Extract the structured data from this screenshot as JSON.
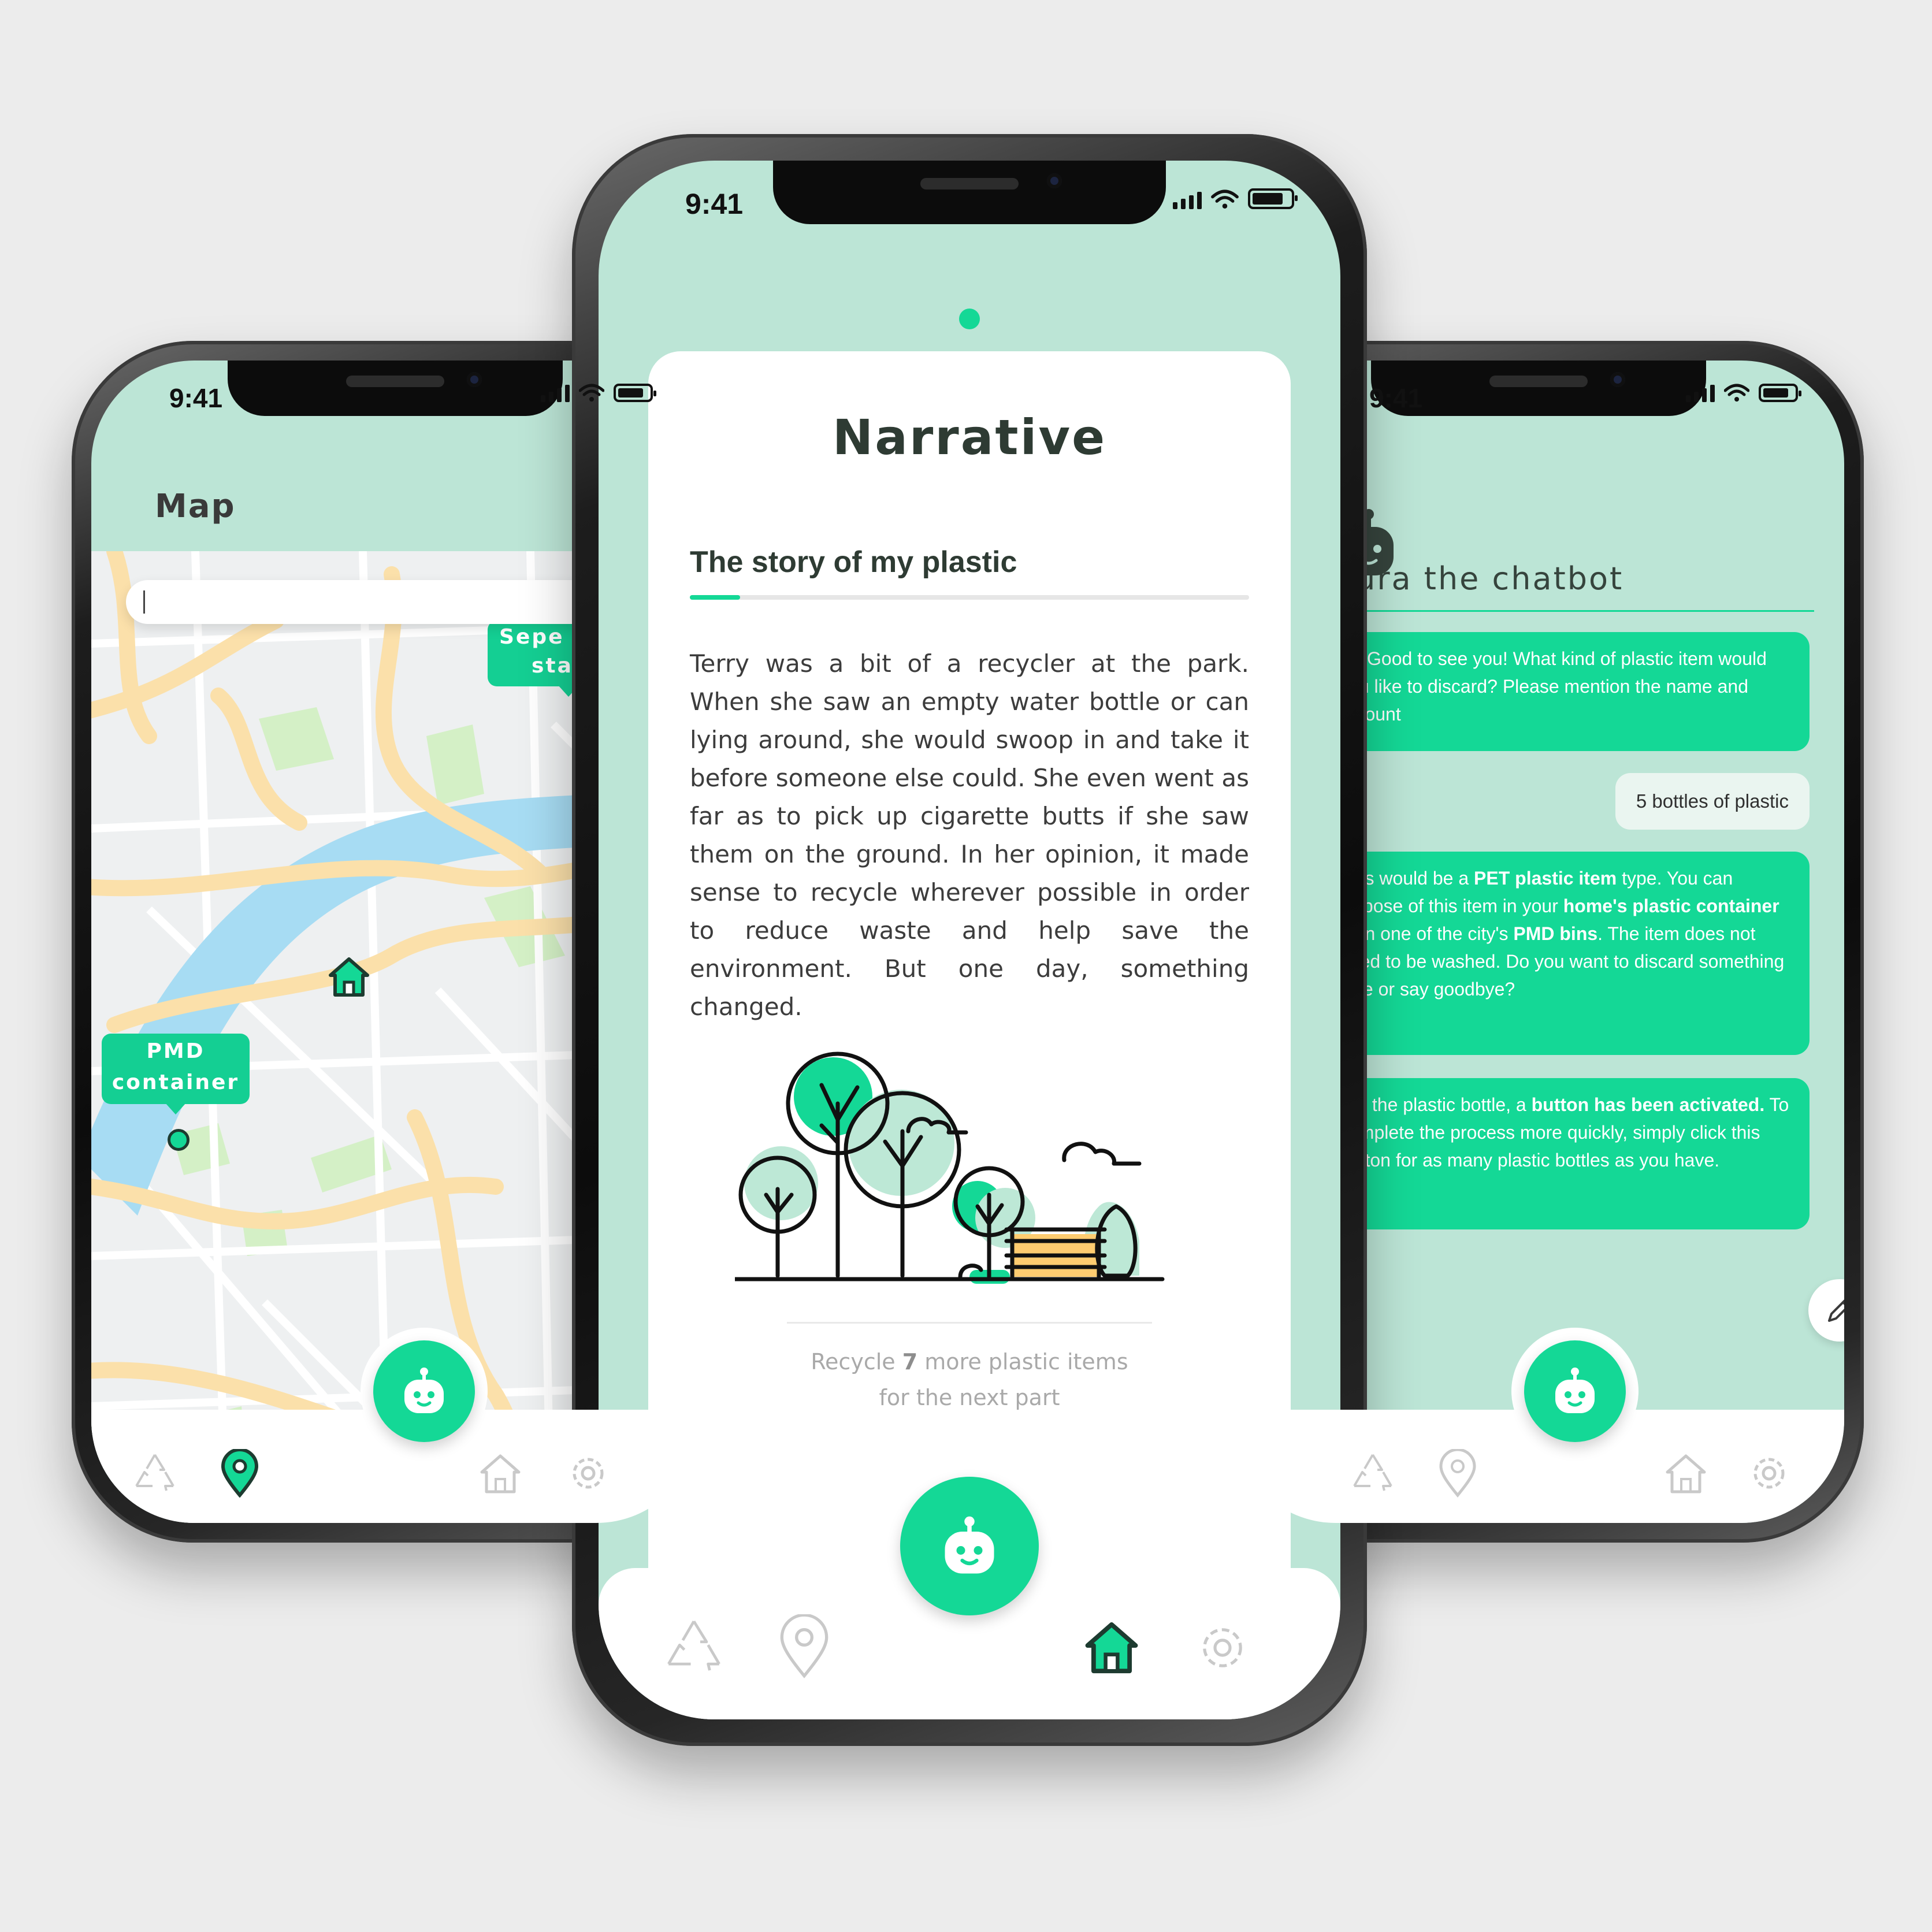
{
  "colors": {
    "accent": "#14d896",
    "screen_background": "#bce5d6",
    "page_background": "#ececec",
    "map_water": "#a7dcf3",
    "map_road": "#fbe0aa",
    "map_park": "#d4f0c6"
  },
  "status_bar": {
    "time": "9:41"
  },
  "map_screen": {
    "title": "Map",
    "search": {
      "value": "",
      "placeholder": ""
    },
    "tags": [
      {
        "line1": "PMD",
        "line2": "container"
      },
      {
        "line1": "Sepe",
        "line2": "sta"
      }
    ],
    "icons": [
      "home-marker-icon",
      "location-dot-icon"
    ]
  },
  "narrative_screen": {
    "title": "Narrative",
    "section_title": "The story of my plastic",
    "progress": 0.09,
    "story": "Terry was a bit of a recycler at the park. When she saw an empty water bottle or can lying around, she would swoop in and take it before someone else could. She even went as far as to pick up cigarette butts if she saw them on the ground. In her opinion, it made sense to recycle wherever possible in order to reduce waste and help save the environment. But one day, something changed.",
    "illustration": "park-trees-bench-illustration",
    "recycle_note": {
      "prefix": "Recycle ",
      "count": "7",
      "suffix": " more plastic items",
      "line2": "for the next part"
    }
  },
  "chat_screen": {
    "title": "aura the chatbot",
    "messages": [
      {
        "from": "bot",
        "parts": [
          {
            "text": "Hi! Good to see you! What kind of plastic item would you like to discard? Please mention the name and amount",
            "bold": false
          }
        ]
      },
      {
        "from": "user",
        "text": "5 bottles of plastic"
      },
      {
        "from": "bot",
        "parts": [
          {
            "text": "This would be a ",
            "bold": false
          },
          {
            "text": "PET plastic item",
            "bold": true
          },
          {
            "text": " type. You can dispose of this item in your ",
            "bold": false
          },
          {
            "text": "home's plastic container",
            "bold": true
          },
          {
            "text": " or in one of the city's ",
            "bold": false
          },
          {
            "text": "PMD bins",
            "bold": true
          },
          {
            "text": ". The item does not need to be washed. Do you want to discard something else or say goodbye?",
            "bold": false
          }
        ]
      },
      {
        "from": "bot",
        "parts": [
          {
            "text": "For the plastic bottle, a ",
            "bold": false
          },
          {
            "text": "button has been activated.",
            "bold": true
          },
          {
            "text": " To complete the process more quickly, simply click this button for as many plastic bottles as you have.",
            "bold": false
          }
        ]
      }
    ],
    "buttons": [
      "plastic-bottle-icon",
      "pencil-icon"
    ]
  },
  "navbar": {
    "items": [
      "recycle-icon",
      "location-pin-icon",
      "chatbot-icon",
      "home-icon",
      "gear-icon"
    ],
    "active": {
      "map": "location-pin-icon",
      "narrative": "home-icon",
      "chat": "none"
    }
  }
}
